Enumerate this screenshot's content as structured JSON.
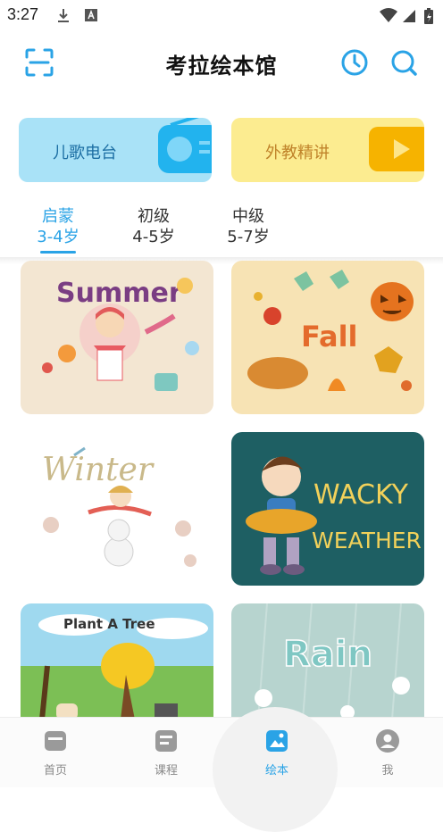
{
  "status_bar": {
    "time": "3:27"
  },
  "header": {
    "title": "考拉绘本馆",
    "icons": [
      "scan-icon",
      "history-icon",
      "search-icon"
    ]
  },
  "cards": [
    {
      "label": "儿歌电台",
      "color": "#a9e2f7"
    },
    {
      "label": "外教精讲",
      "color": "#fcec90"
    }
  ],
  "tabs": [
    {
      "name": "启蒙",
      "age": "3-4岁",
      "active": true
    },
    {
      "name": "初级",
      "age": "4-5岁",
      "active": false
    },
    {
      "name": "中级",
      "age": "5-7岁",
      "active": false
    }
  ],
  "books": [
    {
      "title": "Summer"
    },
    {
      "title": "Fall"
    },
    {
      "title": "Winter"
    },
    {
      "title": "WACKY WEATHER"
    },
    {
      "title": "Plant A Tree"
    },
    {
      "title": "Rain"
    }
  ],
  "bottom_nav": [
    {
      "label": "首页",
      "icon": "home-icon",
      "active": false
    },
    {
      "label": "课程",
      "icon": "course-icon",
      "active": false
    },
    {
      "label": "绘本",
      "icon": "picturebook-icon",
      "active": true
    },
    {
      "label": "我",
      "icon": "profile-icon",
      "active": false
    }
  ],
  "colors": {
    "accent": "#2aa3e6"
  }
}
